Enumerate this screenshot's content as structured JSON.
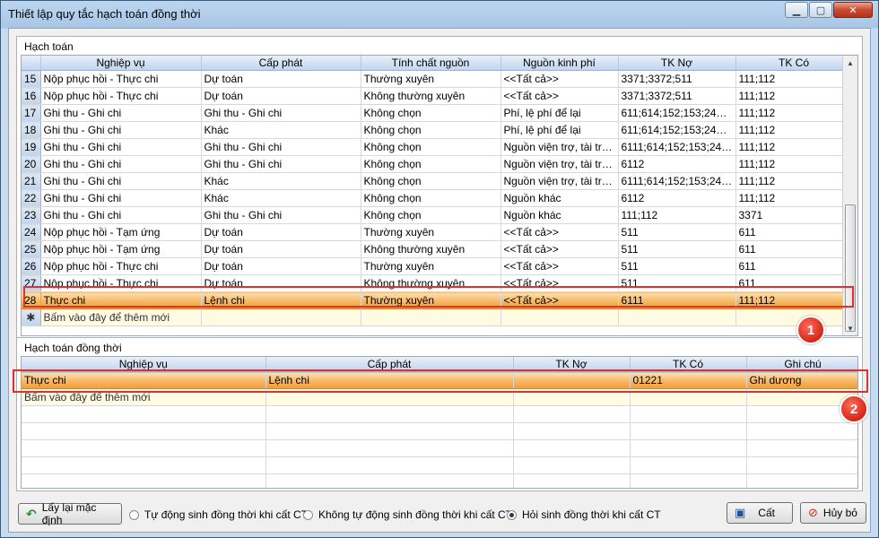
{
  "window": {
    "title": "Thiết lập quy tắc hạch toán đồng thời"
  },
  "hachtoan": {
    "group_title": "Hạch toán",
    "columns": [
      "",
      "Nghiệp vụ",
      "Cấp phát",
      "Tính chất nguồn",
      "Nguồn kinh phí",
      "TK Nợ",
      "TK Có"
    ],
    "rows": [
      [
        "15",
        "Nộp phục hồi - Thực chi",
        "Dự toán",
        "Thường xuyên",
        "<<Tất cả>>",
        "3371;3372;511",
        "111;112"
      ],
      [
        "16",
        "Nộp phục hồi - Thực chi",
        "Dự toán",
        "Không thường xuyên",
        "<<Tất cả>>",
        "3371;3372;511",
        "111;112"
      ],
      [
        "17",
        "Ghi thu - Ghi chi",
        "Ghi thu - Ghi chi",
        "Không chọn",
        "Phí, lệ phí để lại",
        "611;614;152;153;241;2...",
        "111;112"
      ],
      [
        "18",
        "Ghi thu - Ghi chi",
        "Khác",
        "Không chọn",
        "Phí, lệ phí để lại",
        "611;614;152;153;241;2...",
        "111;112"
      ],
      [
        "19",
        "Ghi thu - Ghi chi",
        "Ghi thu - Ghi chi",
        "Không chọn",
        "Nguồn viện trợ, tài trợ;...",
        "6111;614;152;153;241;...",
        "111;112"
      ],
      [
        "20",
        "Ghi thu - Ghi chi",
        "Ghi thu - Ghi chi",
        "Không chọn",
        "Nguồn viện trợ, tài trợ;...",
        "6112",
        "111;112"
      ],
      [
        "21",
        "Ghi thu - Ghi chi",
        "Khác",
        "Không chọn",
        "Nguồn viện trợ, tài trợ;...",
        "6111;614;152;153;241;...",
        "111;112"
      ],
      [
        "22",
        "Ghi thu - Ghi chi",
        "Khác",
        "Không chọn",
        "Nguồn khác",
        "6112",
        "111;112"
      ],
      [
        "23",
        "Ghi thu - Ghi chi",
        "Ghi thu - Ghi chi",
        "Không chọn",
        "Nguồn khác",
        "111;112",
        "3371"
      ],
      [
        "24",
        "Nộp phục hồi - Tạm ứng",
        "Dự toán",
        "Thường xuyên",
        "<<Tất cả>>",
        "511",
        "611"
      ],
      [
        "25",
        "Nộp phục hồi - Tạm ứng",
        "Dự toán",
        "Không thường xuyên",
        "<<Tất cả>>",
        "511",
        "611"
      ],
      [
        "26",
        "Nộp phục hồi - Thực chi",
        "Dự toán",
        "Thường xuyên",
        "<<Tất cả>>",
        "511",
        "611"
      ],
      [
        "27",
        "Nộp phục hồi - Thực chi",
        "Dự toán",
        "Không thường xuyên",
        "<<Tất cả>>",
        "511",
        "611"
      ]
    ],
    "selected_row": [
      "28",
      "Thực chi",
      "Lệnh chi",
      "Thường xuyên",
      "<<Tất cả>>",
      "6111",
      "111;112"
    ],
    "new_row_marker": "✱",
    "new_row_text": "Bấm vào đây để thêm mới"
  },
  "dongthoi": {
    "group_title": "Hạch toán đồng thời",
    "columns": [
      "Nghiệp vụ",
      "Cấp phát",
      "TK Nợ",
      "TK Có",
      "Ghi chú"
    ],
    "selected_row": [
      "Thực chi",
      "Lệnh chi",
      "",
      "01221",
      "Ghi dương"
    ],
    "new_row_text": "Bấm vào đây để thêm mới"
  },
  "annotations": {
    "badge1": "1",
    "badge2": "2"
  },
  "footer": {
    "reset_label": "Lấy lại mặc định",
    "radio1": "Tự động sinh đồng thời khi cất CT",
    "radio2": "Không tự động sinh đồng thời khi cất CT",
    "radio3": "Hỏi sinh đồng thời khi cất CT",
    "selected_radio": 3,
    "save_label": "Cất",
    "cancel_label": "Hủy bỏ"
  }
}
